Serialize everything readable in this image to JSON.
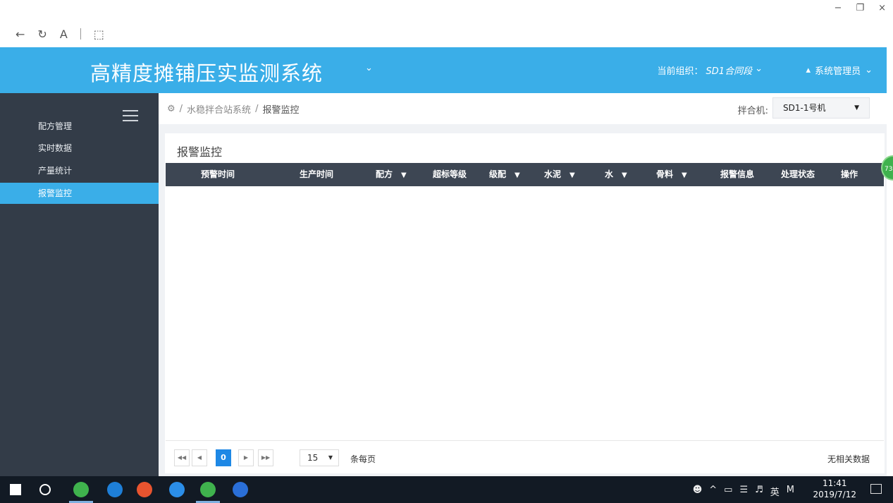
{
  "window": {
    "minimize": "−",
    "restore": "❐",
    "close": "×"
  },
  "browser": {
    "back": "←",
    "reload": "↻",
    "reader": "A",
    "tabs": "⬚"
  },
  "header": {
    "title": "高精度摊铺压实监测系统",
    "org_label": "当前组织：",
    "org_value": "SD1合同段",
    "user": "系统管理员",
    "accent": "#3aaee8"
  },
  "sidebar": {
    "items": [
      {
        "label": "配方管理"
      },
      {
        "label": "实时数据"
      },
      {
        "label": "产量统计"
      },
      {
        "label": "报警监控",
        "active": true
      }
    ]
  },
  "breadcrumb": {
    "root": "水稳拌合站系统",
    "current": "报警监控"
  },
  "mixer": {
    "label": "拌合机:",
    "value": "SD1-1号机"
  },
  "panel": {
    "title": "报警监控"
  },
  "table": {
    "columns": [
      "预警时间",
      "生产时间",
      "配方",
      "超标等级",
      "级配",
      "水泥",
      "水",
      "骨料",
      "报警信息",
      "处理状态",
      "操作"
    ],
    "rows": []
  },
  "pager": {
    "current_page": "0",
    "page_size": "15",
    "per_page_label": "条每页",
    "empty_text": "无相关数据"
  },
  "badge": {
    "text": "73"
  },
  "taskbar": {
    "time": "11:41",
    "date": "2019/7/12",
    "ime": "英",
    "ime_mode": "M"
  }
}
